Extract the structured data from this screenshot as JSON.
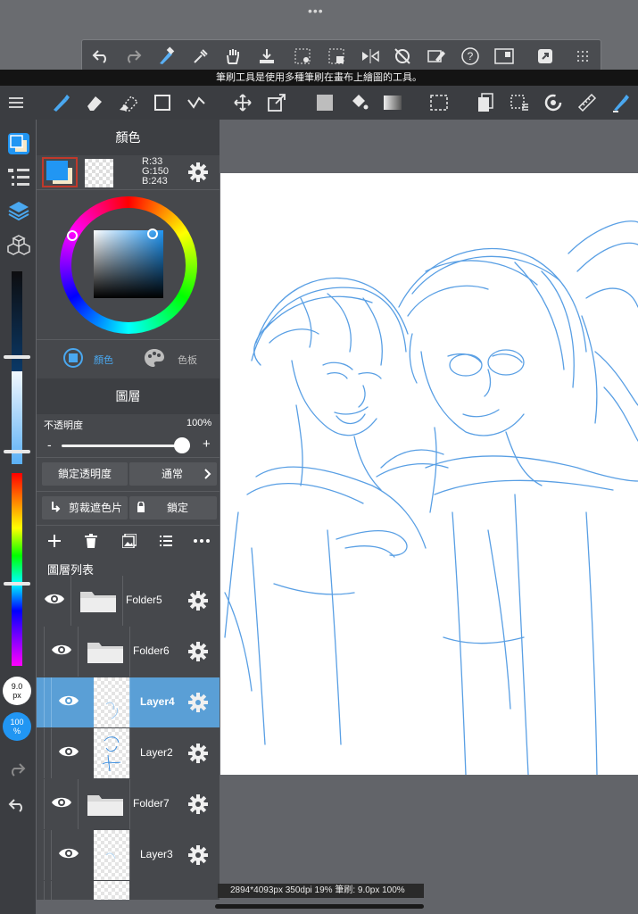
{
  "top": {
    "dots": "•••"
  },
  "hint": "筆刷工具是使用多種筆刷在畫布上繪圖的工具。",
  "quick_toolbar": [
    "undo-icon",
    "redo-icon",
    "brush-eraser-toggle-icon",
    "eyedropper-icon",
    "hand-icon",
    "import-icon",
    "select-transform-icon",
    "select-fill-icon",
    "flip-icon",
    "rotate-off-icon",
    "eraser-selection-icon",
    "help-icon",
    "window-icon",
    "share-icon",
    "grid-icon"
  ],
  "color_panel": {
    "title": "顏色",
    "rgb": {
      "r": "R:33",
      "g": "G:150",
      "b": "B:243"
    },
    "main_color": "#2196f3",
    "tab_color": "顏色",
    "tab_palette": "色板"
  },
  "layer_panel": {
    "title": "圖層",
    "opacity_label": "不透明度",
    "opacity_value": "100%",
    "opacity": 1.0,
    "minus": "-",
    "plus": "+",
    "lock_alpha": "鎖定透明度",
    "blend_mode": "通常",
    "clipping": "剪裁遮色片",
    "lock": "鎖定",
    "list_label": "圖層列表",
    "layers": [
      {
        "name": "Folder5",
        "type": "folder",
        "selected": false
      },
      {
        "name": "Folder6",
        "type": "folder",
        "selected": false
      },
      {
        "name": "Layer4",
        "type": "layer",
        "selected": true
      },
      {
        "name": "Layer2",
        "type": "layer",
        "selected": false
      },
      {
        "name": "Folder7",
        "type": "folder",
        "selected": false
      },
      {
        "name": "Layer3",
        "type": "layer",
        "selected": false
      }
    ]
  },
  "rail": {
    "brush_size": "9.0",
    "brush_unit": "px",
    "opacity": "100",
    "opacity_unit": "%"
  },
  "status": "2894*4093px 350dpi 19% 筆刷: 9.0px 100%",
  "colors": {
    "accent": "#2196f3",
    "selected_row": "#5a9fd6",
    "sketch": "#3d8fe0"
  }
}
